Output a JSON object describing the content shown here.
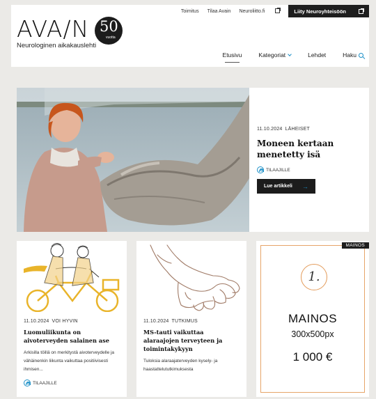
{
  "header": {
    "logo_text": "AVA/N",
    "logo_badge_number": "50",
    "logo_badge_sub": "vuotta",
    "tagline": "Neurologinen aikakauslehti",
    "toplinks": [
      "Toimitus",
      "Tilaa Avain",
      "Neuroliitto.fi"
    ],
    "join_label": "Liity Neuroyhteisöön",
    "nav": {
      "home": "Etusivu",
      "categories": "Kategoriat",
      "issues": "Lehdet",
      "search": "Haku"
    }
  },
  "hero": {
    "date": "11.10.2024",
    "category": "LÄHEISET",
    "title": "Moneen kertaan menetetty isä",
    "subscribers": "TILAAJILLE",
    "button": "Lue artikkeli"
  },
  "cards": [
    {
      "date": "11.10.2024",
      "category": "VOI HYVIN",
      "title": "Luomuliikunta on aivoterveyden salainen ase",
      "desc": "Arkisilla töillä on merkitystä aivoterveydelle ja vähäinenkin liikunta vaikuttaa positiivisesti ihmisen...",
      "subscribers": "TILAAJILLE"
    },
    {
      "date": "11.10.2024",
      "category": "TUTKIMUS",
      "title": "MS-tauti vaikuttaa alaraajojen terveyteen ja toimintakykyyn",
      "desc": "Tuloksia alaraajaterveyden kysely- ja haastattelututkimuksesta"
    }
  ],
  "ad": {
    "label": "MAINOS",
    "number": "1.",
    "title": "MAINOS",
    "size": "300x500px",
    "price": "1 000 €"
  },
  "colors": {
    "accent": "#1a8fc7",
    "ad_border": "#e6a468",
    "dark": "#1e1e1e"
  }
}
